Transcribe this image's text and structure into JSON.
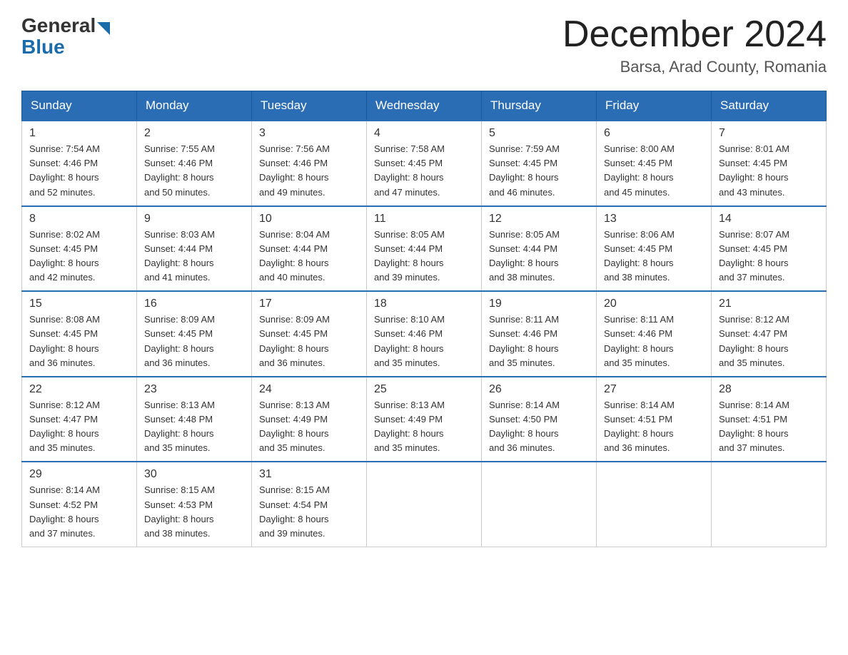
{
  "header": {
    "logo_general": "General",
    "logo_blue": "Blue",
    "month_title": "December 2024",
    "location": "Barsa, Arad County, Romania"
  },
  "days_of_week": [
    "Sunday",
    "Monday",
    "Tuesday",
    "Wednesday",
    "Thursday",
    "Friday",
    "Saturday"
  ],
  "weeks": [
    [
      {
        "day": "1",
        "sunrise": "7:54 AM",
        "sunset": "4:46 PM",
        "daylight": "8 hours and 52 minutes."
      },
      {
        "day": "2",
        "sunrise": "7:55 AM",
        "sunset": "4:46 PM",
        "daylight": "8 hours and 50 minutes."
      },
      {
        "day": "3",
        "sunrise": "7:56 AM",
        "sunset": "4:46 PM",
        "daylight": "8 hours and 49 minutes."
      },
      {
        "day": "4",
        "sunrise": "7:58 AM",
        "sunset": "4:45 PM",
        "daylight": "8 hours and 47 minutes."
      },
      {
        "day": "5",
        "sunrise": "7:59 AM",
        "sunset": "4:45 PM",
        "daylight": "8 hours and 46 minutes."
      },
      {
        "day": "6",
        "sunrise": "8:00 AM",
        "sunset": "4:45 PM",
        "daylight": "8 hours and 45 minutes."
      },
      {
        "day": "7",
        "sunrise": "8:01 AM",
        "sunset": "4:45 PM",
        "daylight": "8 hours and 43 minutes."
      }
    ],
    [
      {
        "day": "8",
        "sunrise": "8:02 AM",
        "sunset": "4:45 PM",
        "daylight": "8 hours and 42 minutes."
      },
      {
        "day": "9",
        "sunrise": "8:03 AM",
        "sunset": "4:44 PM",
        "daylight": "8 hours and 41 minutes."
      },
      {
        "day": "10",
        "sunrise": "8:04 AM",
        "sunset": "4:44 PM",
        "daylight": "8 hours and 40 minutes."
      },
      {
        "day": "11",
        "sunrise": "8:05 AM",
        "sunset": "4:44 PM",
        "daylight": "8 hours and 39 minutes."
      },
      {
        "day": "12",
        "sunrise": "8:05 AM",
        "sunset": "4:44 PM",
        "daylight": "8 hours and 38 minutes."
      },
      {
        "day": "13",
        "sunrise": "8:06 AM",
        "sunset": "4:45 PM",
        "daylight": "8 hours and 38 minutes."
      },
      {
        "day": "14",
        "sunrise": "8:07 AM",
        "sunset": "4:45 PM",
        "daylight": "8 hours and 37 minutes."
      }
    ],
    [
      {
        "day": "15",
        "sunrise": "8:08 AM",
        "sunset": "4:45 PM",
        "daylight": "8 hours and 36 minutes."
      },
      {
        "day": "16",
        "sunrise": "8:09 AM",
        "sunset": "4:45 PM",
        "daylight": "8 hours and 36 minutes."
      },
      {
        "day": "17",
        "sunrise": "8:09 AM",
        "sunset": "4:45 PM",
        "daylight": "8 hours and 36 minutes."
      },
      {
        "day": "18",
        "sunrise": "8:10 AM",
        "sunset": "4:46 PM",
        "daylight": "8 hours and 35 minutes."
      },
      {
        "day": "19",
        "sunrise": "8:11 AM",
        "sunset": "4:46 PM",
        "daylight": "8 hours and 35 minutes."
      },
      {
        "day": "20",
        "sunrise": "8:11 AM",
        "sunset": "4:46 PM",
        "daylight": "8 hours and 35 minutes."
      },
      {
        "day": "21",
        "sunrise": "8:12 AM",
        "sunset": "4:47 PM",
        "daylight": "8 hours and 35 minutes."
      }
    ],
    [
      {
        "day": "22",
        "sunrise": "8:12 AM",
        "sunset": "4:47 PM",
        "daylight": "8 hours and 35 minutes."
      },
      {
        "day": "23",
        "sunrise": "8:13 AM",
        "sunset": "4:48 PM",
        "daylight": "8 hours and 35 minutes."
      },
      {
        "day": "24",
        "sunrise": "8:13 AM",
        "sunset": "4:49 PM",
        "daylight": "8 hours and 35 minutes."
      },
      {
        "day": "25",
        "sunrise": "8:13 AM",
        "sunset": "4:49 PM",
        "daylight": "8 hours and 35 minutes."
      },
      {
        "day": "26",
        "sunrise": "8:14 AM",
        "sunset": "4:50 PM",
        "daylight": "8 hours and 36 minutes."
      },
      {
        "day": "27",
        "sunrise": "8:14 AM",
        "sunset": "4:51 PM",
        "daylight": "8 hours and 36 minutes."
      },
      {
        "day": "28",
        "sunrise": "8:14 AM",
        "sunset": "4:51 PM",
        "daylight": "8 hours and 37 minutes."
      }
    ],
    [
      {
        "day": "29",
        "sunrise": "8:14 AM",
        "sunset": "4:52 PM",
        "daylight": "8 hours and 37 minutes."
      },
      {
        "day": "30",
        "sunrise": "8:15 AM",
        "sunset": "4:53 PM",
        "daylight": "8 hours and 38 minutes."
      },
      {
        "day": "31",
        "sunrise": "8:15 AM",
        "sunset": "4:54 PM",
        "daylight": "8 hours and 39 minutes."
      },
      null,
      null,
      null,
      null
    ]
  ],
  "labels": {
    "sunrise": "Sunrise:",
    "sunset": "Sunset:",
    "daylight": "Daylight:"
  }
}
